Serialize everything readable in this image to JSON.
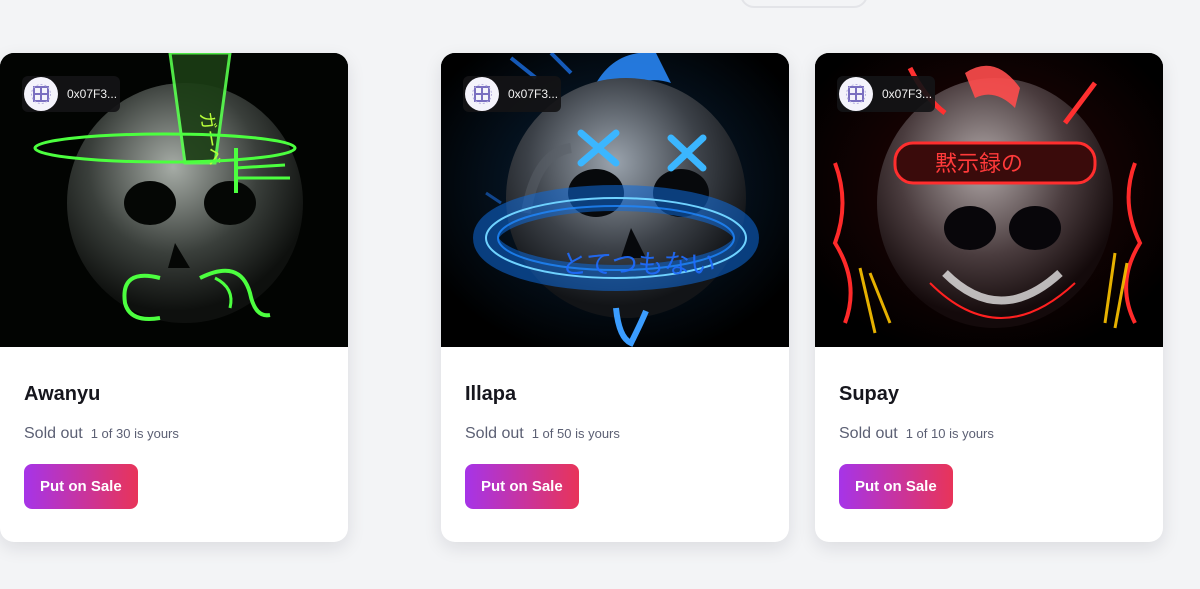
{
  "cards": [
    {
      "title": "Illapa",
      "owner_address": "0x07F3...",
      "status": "Sold out",
      "ownership": "1 of 50 is yours",
      "button_label": "Put on Sale",
      "art_caption": "とてつもない",
      "accent_color": "#29a8ff"
    },
    {
      "title": "Supay",
      "owner_address": "0x07F3...",
      "status": "Sold out",
      "ownership": "1 of 10 is yours",
      "button_label": "Put on Sale",
      "art_caption": "黙示録の",
      "accent_color": "#ff2b2b"
    },
    {
      "title": "Awanyu",
      "owner_address": "0x07F3...",
      "status": "Sold out",
      "ownership": "1 of 30 is yours",
      "button_label": "Put on Sale",
      "art_caption": "ガーベ",
      "accent_color": "#3dff4a"
    }
  ],
  "colors": {
    "button_gradient_start": "#a634e8",
    "button_gradient_end": "#e83459",
    "page_background": "#f3f4f6"
  },
  "icons": [
    "owner-avatar-icon",
    "skull-artwork"
  ]
}
